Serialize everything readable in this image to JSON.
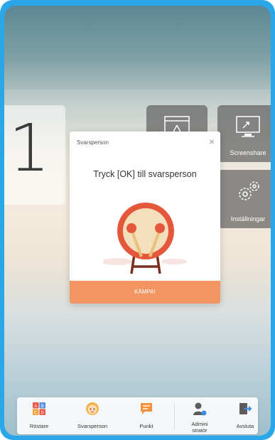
{
  "background": {
    "big_number": "1"
  },
  "tiles": {
    "screenshare_label": "Screenshare",
    "settings_label": "Inställningar"
  },
  "dialog": {
    "title": "Svarsperson",
    "close_symbol": "×",
    "prompt": "Tryck [OK] till svarsperson",
    "action_label": "KÄMPA!"
  },
  "dock": {
    "items": [
      {
        "label": "Röstare",
        "icon": "abcd-grid-icon"
      },
      {
        "label": "Svarsperson",
        "icon": "face-icon"
      },
      {
        "label": "Punkt",
        "icon": "comment-icon"
      },
      {
        "label": "Admini\nstratör",
        "icon": "admin-user-icon"
      },
      {
        "label": "Avsluta",
        "icon": "exit-icon"
      }
    ]
  },
  "colors": {
    "frame": "#2aa7e8",
    "accent": "#f29563",
    "drum_red": "#e4573a",
    "drum_face": "#f4dfbd"
  }
}
